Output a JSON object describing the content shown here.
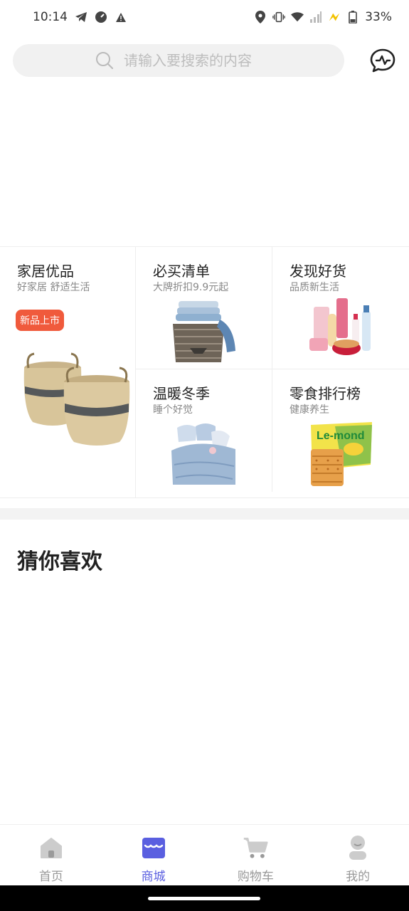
{
  "status": {
    "time": "10:14",
    "battery": "33%"
  },
  "search": {
    "placeholder": "请输入要搜索的内容"
  },
  "promo": {
    "home": {
      "title": "家居优品",
      "subtitle": "好家居 舒适生活",
      "badge": "新品上市"
    },
    "mustbuy": {
      "title": "必买清单",
      "subtitle": "大牌折扣9.9元起"
    },
    "discover": {
      "title": "发现好货",
      "subtitle": "品质新生活"
    },
    "winter": {
      "title": "温暖冬季",
      "subtitle": "睡个好觉"
    },
    "snacks": {
      "title": "零食排行榜",
      "subtitle": "健康养生",
      "product_text": "Le-mond"
    }
  },
  "section": {
    "guess_title": "猜你喜欢"
  },
  "nav": {
    "items": [
      {
        "label": "首页",
        "icon": "home-icon"
      },
      {
        "label": "商城",
        "icon": "store-icon"
      },
      {
        "label": "购物车",
        "icon": "cart-icon"
      },
      {
        "label": "我的",
        "icon": "profile-icon"
      }
    ],
    "active_color": "#5a5fe0",
    "inactive_color": "#cccccc"
  },
  "colors": {
    "badge": "#f05a3c",
    "search_bg": "#f1f1f1"
  }
}
